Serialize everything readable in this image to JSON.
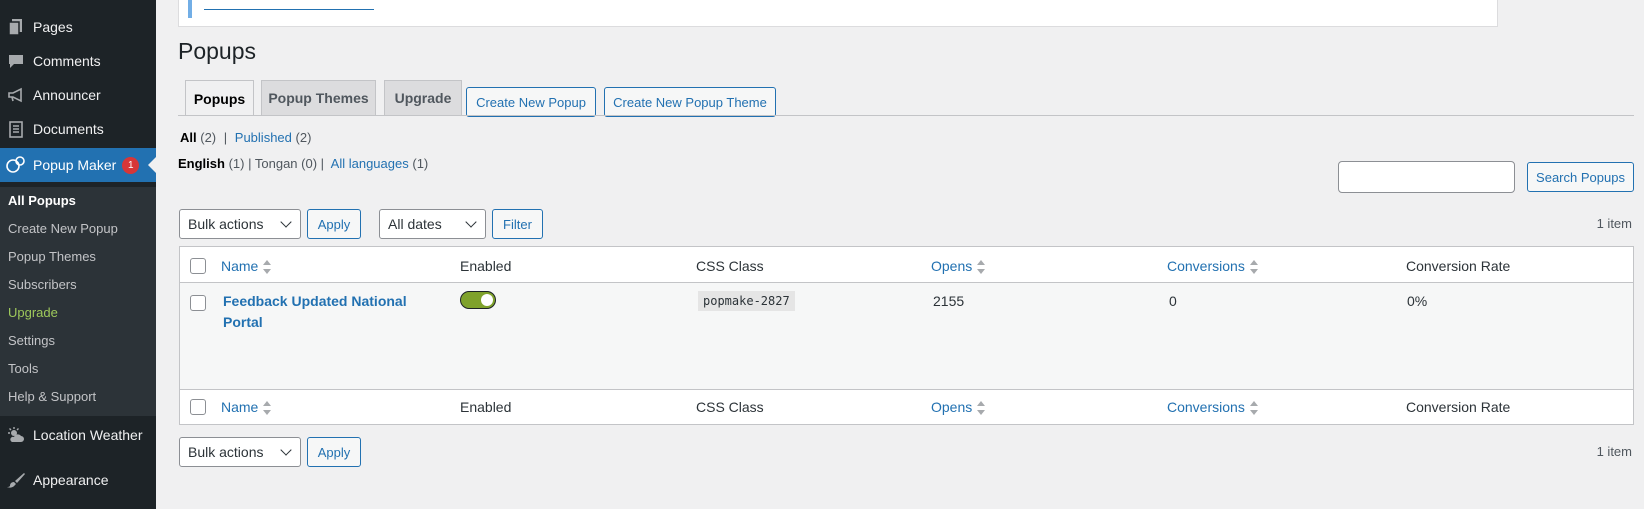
{
  "sidebar": {
    "menu": [
      {
        "label": "Pages",
        "icon": "pages-icon"
      },
      {
        "label": "Comments",
        "icon": "comments-icon"
      },
      {
        "label": "Announcer",
        "icon": "megaphone-icon"
      },
      {
        "label": "Documents",
        "icon": "documents-icon"
      },
      {
        "label": "Popup Maker",
        "icon": "popup-maker-icon",
        "badge": "1"
      },
      {
        "label": "Location Weather",
        "icon": "weather-icon"
      },
      {
        "label": "Appearance",
        "icon": "paintbrush-icon"
      }
    ],
    "submenu": [
      {
        "label": "All Popups"
      },
      {
        "label": "Create New Popup"
      },
      {
        "label": "Popup Themes"
      },
      {
        "label": "Subscribers"
      },
      {
        "label": "Upgrade"
      },
      {
        "label": "Settings"
      },
      {
        "label": "Tools"
      },
      {
        "label": "Help & Support"
      }
    ]
  },
  "page": {
    "title": "Popups",
    "tabs": [
      "Popups",
      "Popup Themes",
      "Upgrade"
    ],
    "buttons": {
      "create_popup": "Create New Popup",
      "create_theme": "Create New Popup Theme"
    }
  },
  "filters": {
    "status": {
      "all": "All",
      "all_count": "(2)",
      "sep": "|",
      "published": "Published",
      "published_count": "(2)"
    },
    "languages": {
      "english": "English",
      "english_count": "(1)",
      "tongan": "Tongan (0)",
      "all": "All languages",
      "all_count": "(1)"
    },
    "search_placeholder": "",
    "search_button": "Search Popups",
    "bulk_actions": "Bulk actions",
    "apply": "Apply",
    "dates": "All dates",
    "filter": "Filter",
    "items_count": "1 item"
  },
  "table": {
    "columns": [
      "Name",
      "Enabled",
      "CSS Class",
      "Opens",
      "Conversions",
      "Conversion Rate"
    ],
    "rows": [
      {
        "name_line1": "Feedback Updated National",
        "name_line2": "Portal",
        "enabled": true,
        "css_class": "popmake-2827",
        "opens": "2155",
        "conversions": "0",
        "conversion_rate": "0%"
      }
    ]
  },
  "colors": {
    "sidebar_bg": "#1d2327",
    "accent": "#2271b1",
    "toggle_on": "#7fa22c",
    "badge": "#d63638"
  }
}
